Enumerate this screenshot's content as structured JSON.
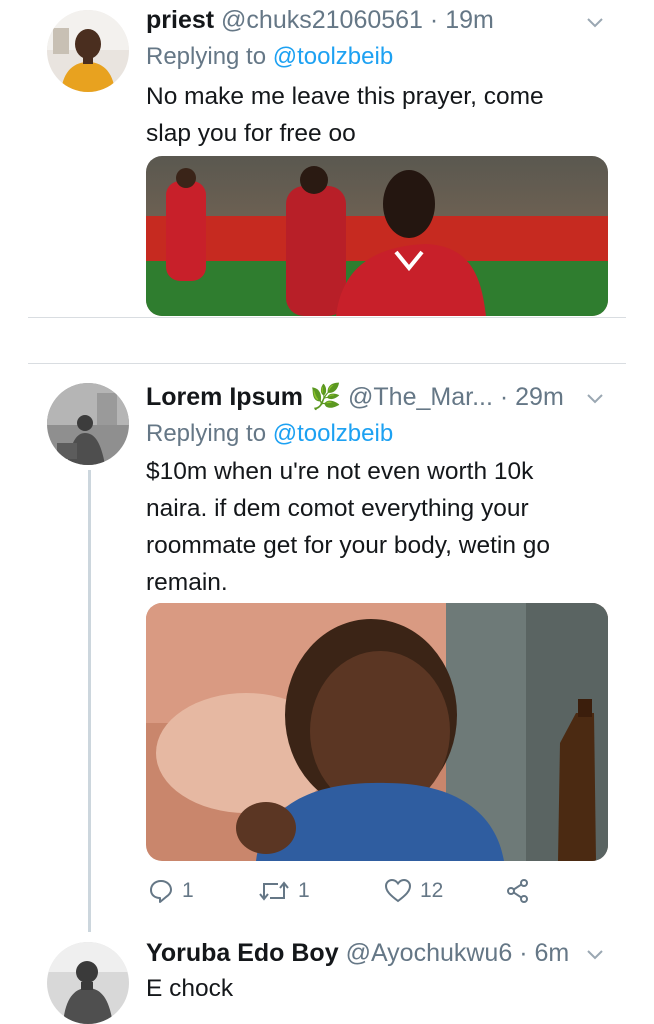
{
  "tweets": [
    {
      "name": "priest",
      "handle": "@chuks21060561",
      "sep": "·",
      "time": "19m",
      "replying_prefix": "Replying to",
      "replying_to": "@toolzbeib",
      "text_lines": [
        "No make me leave this prayer, come",
        "slap you for free oo"
      ]
    },
    {
      "name": "Lorem Ipsum",
      "name_emoji": "🌿",
      "handle": "@The_Mar...",
      "sep": "·",
      "time": "29m",
      "replying_prefix": "Replying to",
      "replying_to": "@toolzbeib",
      "text_lines": [
        "$10m when u're not even worth 10k",
        "naira. if dem comot everything your",
        "roommate get for your body, wetin go",
        "remain."
      ],
      "actions": {
        "replies": "1",
        "retweets": "1",
        "likes": "12"
      }
    },
    {
      "name": "Yoruba Edo Boy",
      "handle": "@Ayochukwu6",
      "sep": "·",
      "time": "6m",
      "text_lines": [
        "E chock"
      ]
    }
  ],
  "icons": [
    "chevron-down-icon",
    "reply-icon",
    "retweet-icon",
    "like-icon",
    "share-icon"
  ],
  "colors": {
    "link": "#1da1f2",
    "muted": "#657786",
    "text": "#14171a",
    "divider": "#d9dde1"
  }
}
